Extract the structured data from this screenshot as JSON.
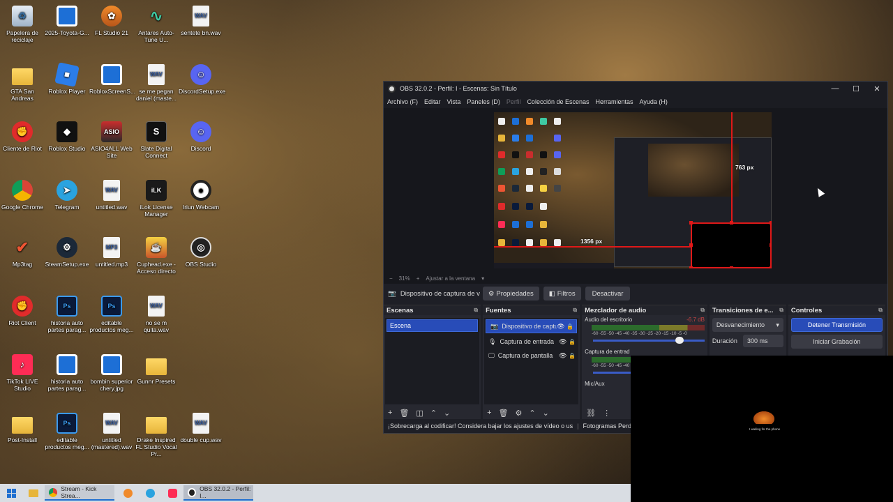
{
  "desktop": {
    "icons": [
      {
        "label": "Papelera de reciclaje",
        "icon": "recycle-bin-icon",
        "x": 0
      },
      {
        "label": "2025-Toyota-G...",
        "icon": "image-file-icon"
      },
      {
        "label": "FL Studio 21",
        "icon": "fl-studio-icon"
      },
      {
        "label": "Antares Auto-Tune U...",
        "icon": "antares-icon"
      },
      {
        "label": "sentete bn.wav",
        "icon": "wav-file-icon"
      },
      {
        "label": "GTA San Andreas",
        "icon": "folder-icon"
      },
      {
        "label": "Roblox Player",
        "icon": "roblox-icon"
      },
      {
        "label": "RobloxScreenS...",
        "icon": "image-file-icon"
      },
      {
        "label": "se me pegan daniel (maste...",
        "icon": "wav-file-icon"
      },
      {
        "label": "DiscordSetup.exe",
        "icon": "discord-icon"
      },
      {
        "label": "Cliente de Riot",
        "icon": "riot-icon"
      },
      {
        "label": "Roblox Studio",
        "icon": "roblox-studio-icon"
      },
      {
        "label": "ASIO4ALL Web Site",
        "icon": "asio-icon"
      },
      {
        "label": "Slate Digital Connect",
        "icon": "slate-icon"
      },
      {
        "label": "Discord",
        "icon": "discord-icon"
      },
      {
        "label": "Google Chrome",
        "icon": "chrome-icon"
      },
      {
        "label": "Telegram",
        "icon": "telegram-icon"
      },
      {
        "label": "untitled.wav",
        "icon": "wav-file-icon"
      },
      {
        "label": "iLok License Manager",
        "icon": "ilok-icon"
      },
      {
        "label": "Iriun Webcam",
        "icon": "webcam-icon"
      },
      {
        "label": "Mp3tag",
        "icon": "mp3tag-icon"
      },
      {
        "label": "SteamSetup.exe",
        "icon": "steam-icon"
      },
      {
        "label": "untitled.mp3",
        "icon": "mp3-file-icon"
      },
      {
        "label": "Cuphead.exe - Acceso directo",
        "icon": "cuphead-icon"
      },
      {
        "label": "OBS Studio",
        "icon": "obs-icon"
      },
      {
        "label": "Riot Client",
        "icon": "riot-icon"
      },
      {
        "label": "historia auto partes parag...",
        "icon": "psd-file-icon"
      },
      {
        "label": "editable productos meg...",
        "icon": "psd-file-icon"
      },
      {
        "label": "no se m quita.wav",
        "icon": "wav-file-icon"
      },
      {
        "label": "TikTok LIVE Studio",
        "icon": "tiktok-icon"
      },
      {
        "label": "historia auto partes parag...",
        "icon": "image-file-icon"
      },
      {
        "label": "bombin superior chery.jpg",
        "icon": "image-file-icon"
      },
      {
        "label": "Gunnr Presets",
        "icon": "folder-icon"
      },
      {
        "label": "Post-Install",
        "icon": "folder-icon"
      },
      {
        "label": "editable productos meg...",
        "icon": "psd-file-icon"
      },
      {
        "label": "untitled (mastered).wav",
        "icon": "wav-file-icon"
      },
      {
        "label": "Drake Inspired FL Studio Vocal Pr...",
        "icon": "folder-icon"
      },
      {
        "label": "double cup.wav",
        "icon": "wav-file-icon"
      }
    ]
  },
  "obs": {
    "title": "OBS 32.0.2 - Perfil: I - Escenas: Sin Título",
    "menu": [
      "Archivo (F)",
      "Editar",
      "Vista",
      "Paneles (D)",
      "Perfil",
      "Colección de Escenas",
      "Herramientas",
      "Ayuda (H)"
    ],
    "preview": {
      "label_h": "763 px",
      "label_w": "1356 px"
    },
    "zoom": {
      "minus": "−",
      "percent": "31%",
      "plus": "+",
      "fit": "Ajustar a la ventana",
      "dropdown": "▾"
    },
    "toolbar": {
      "source_name": "Dispositivo de captura de v",
      "properties": "Propiedades",
      "filters": "Filtros",
      "deactivate": "Desactivar"
    },
    "scenes": {
      "header": "Escenas",
      "items": [
        "Escena"
      ]
    },
    "sources": {
      "header": "Fuentes",
      "items": [
        "Dispositivo de captu",
        "Captura de entrada",
        "Captura de pantalla"
      ]
    },
    "mixer": {
      "header": "Mezclador de audio",
      "channels": [
        {
          "name": "Audio del escritorio",
          "db": "-6.7 dB"
        },
        {
          "name": "Captura de entrad",
          "db": ""
        },
        {
          "name": "Mic/Aux",
          "db": ""
        }
      ],
      "scale": "-60 -55 -50 -45 -40 -35 -30 -25 -20 -15 -10 -5 -0"
    },
    "transitions": {
      "header": "Transiciones de e...",
      "selected": "Desvanecimiento",
      "duration_label": "Duración",
      "duration_value": "300 ms"
    },
    "controls": {
      "header": "Controles",
      "stop_stream": "Detener Transmisión",
      "start_record": "Iniciar Grabación"
    },
    "status": {
      "warning": "¡Sobrecarga al codificar! Considera bajar los ajustes de vídeo o us",
      "dropped": "Fotogramas Perdidos"
    }
  },
  "overlay": {
    "caption": "I waiting for the phone"
  },
  "taskbar": {
    "tasks": [
      "Stream - Kick Strea...",
      "OBS 32.0.2 - Perfil: I..."
    ]
  }
}
